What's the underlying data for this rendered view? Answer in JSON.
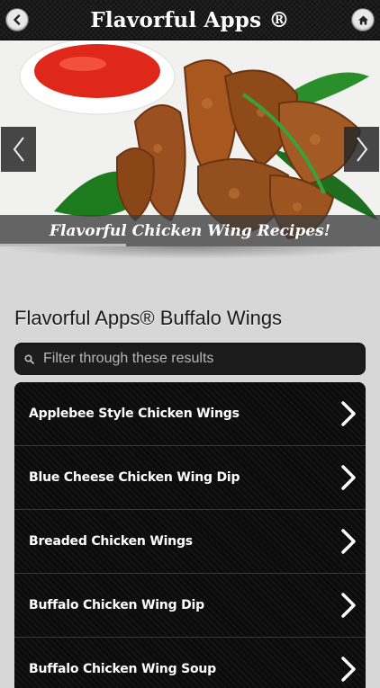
{
  "header": {
    "title": "Flavorful Apps ®",
    "back_icon": "back-arrow-icon",
    "home_icon": "home-icon"
  },
  "slider": {
    "caption": "Flavorful Chicken Wing Recipes!",
    "prev_icon": "chevron-left-icon",
    "next_icon": "chevron-right-icon"
  },
  "page": {
    "title": "Flavorful Apps® Buffalo Wings"
  },
  "search": {
    "placeholder": "Filter through these results",
    "icon": "search-icon"
  },
  "list": {
    "items": [
      {
        "label": "Applebee Style Chicken Wings"
      },
      {
        "label": "Blue Cheese Chicken Wing Dip"
      },
      {
        "label": "Breaded Chicken Wings"
      },
      {
        "label": "Buffalo Chicken Wing Dip"
      },
      {
        "label": "Buffalo Chicken Wing Soup"
      }
    ]
  },
  "colors": {
    "header_bg": "#111111",
    "list_bg": "#0c0c0c",
    "page_bg": "#d7d7d7"
  }
}
